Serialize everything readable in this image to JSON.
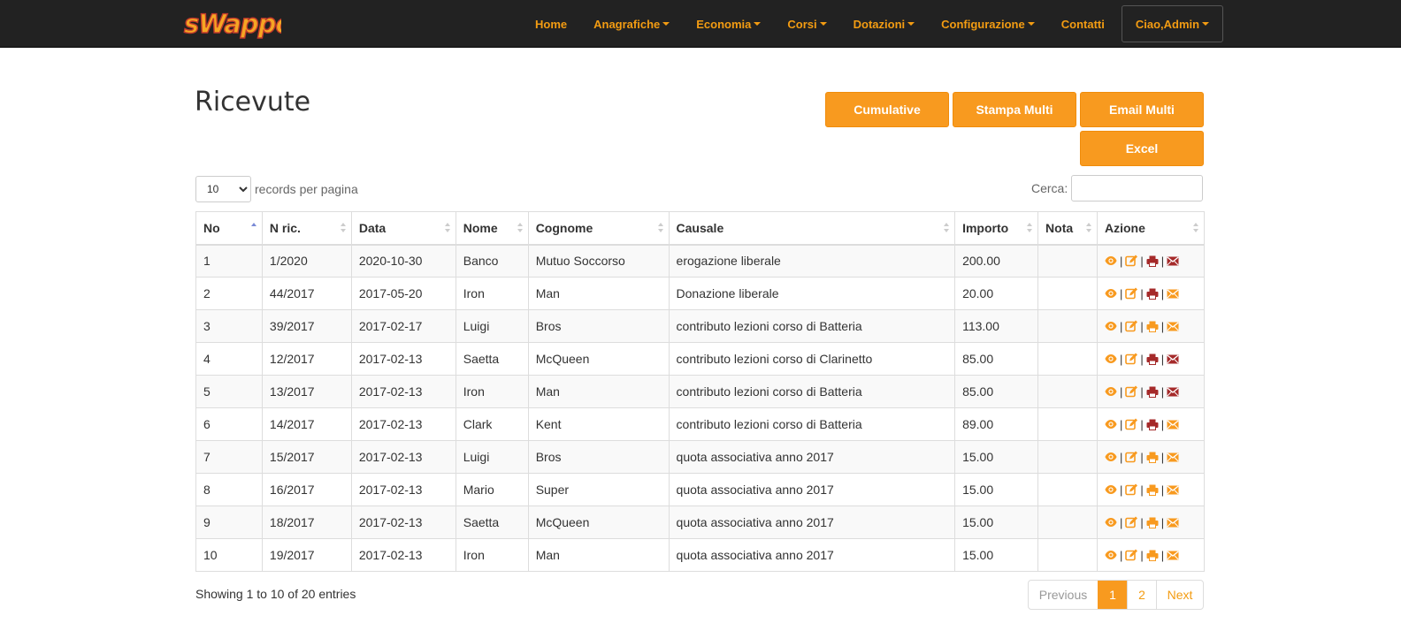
{
  "app": {
    "logo_text": "SWAPPO",
    "colors": {
      "navbar": "#222222",
      "accent": "#f89a1f",
      "accent_text": "#f39c12",
      "icon_dark": "#a52a2a"
    }
  },
  "nav": {
    "items": [
      {
        "label": "Home",
        "has_caret": false
      },
      {
        "label": "Anagrafiche",
        "has_caret": true
      },
      {
        "label": "Economia",
        "has_caret": true
      },
      {
        "label": "Corsi",
        "has_caret": true
      },
      {
        "label": "Dotazioni",
        "has_caret": true
      },
      {
        "label": "Configurazione",
        "has_caret": true
      },
      {
        "label": "Contatti",
        "has_caret": false
      }
    ],
    "user_label": "Ciao,Admin"
  },
  "page": {
    "title": "Ricevute",
    "buttons": {
      "cumulative": "Cumulative",
      "stampa_multi": "Stampa Multi",
      "email_multi": "Email Multi",
      "excel": "Excel"
    }
  },
  "controls": {
    "length_value": "10",
    "length_label": "records per pagina",
    "search_label": "Cerca:",
    "search_value": ""
  },
  "table": {
    "columns": [
      "No",
      "N ric.",
      "Data",
      "Nome",
      "Cognome",
      "Causale",
      "Importo",
      "Nota",
      "Azione"
    ],
    "rows": [
      {
        "no": "1",
        "nric": "1/2020",
        "data": "2020-10-30",
        "nome": "Banco",
        "cognome": "Mutuo Soccorso",
        "causale": "erogazione liberale",
        "importo": "200.00",
        "nota": "",
        "print_icon": "dark",
        "mail_icon": "dark"
      },
      {
        "no": "2",
        "nric": "44/2017",
        "data": "2017-05-20",
        "nome": "Iron",
        "cognome": "Man",
        "causale": "Donazione liberale",
        "importo": "20.00",
        "nota": "",
        "print_icon": "dark",
        "mail_icon": "orange"
      },
      {
        "no": "3",
        "nric": "39/2017",
        "data": "2017-02-17",
        "nome": "Luigi",
        "cognome": "Bros",
        "causale": "contributo lezioni corso di Batteria",
        "importo": "113.00",
        "nota": "",
        "print_icon": "orange",
        "mail_icon": "orange"
      },
      {
        "no": "4",
        "nric": "12/2017",
        "data": "2017-02-13",
        "nome": "Saetta",
        "cognome": "McQueen",
        "causale": "contributo lezioni corso di Clarinetto",
        "importo": "85.00",
        "nota": "",
        "print_icon": "dark",
        "mail_icon": "dark"
      },
      {
        "no": "5",
        "nric": "13/2017",
        "data": "2017-02-13",
        "nome": "Iron",
        "cognome": "Man",
        "causale": "contributo lezioni corso di Batteria",
        "importo": "85.00",
        "nota": "",
        "print_icon": "dark",
        "mail_icon": "dark"
      },
      {
        "no": "6",
        "nric": "14/2017",
        "data": "2017-02-13",
        "nome": "Clark",
        "cognome": "Kent",
        "causale": "contributo lezioni corso di Batteria",
        "importo": "89.00",
        "nota": "",
        "print_icon": "dark",
        "mail_icon": "orange"
      },
      {
        "no": "7",
        "nric": "15/2017",
        "data": "2017-02-13",
        "nome": "Luigi",
        "cognome": "Bros",
        "causale": "quota associativa anno 2017",
        "importo": "15.00",
        "nota": "",
        "print_icon": "orange",
        "mail_icon": "orange"
      },
      {
        "no": "8",
        "nric": "16/2017",
        "data": "2017-02-13",
        "nome": "Mario",
        "cognome": "Super",
        "causale": "quota associativa anno 2017",
        "importo": "15.00",
        "nota": "",
        "print_icon": "orange",
        "mail_icon": "orange"
      },
      {
        "no": "9",
        "nric": "18/2017",
        "data": "2017-02-13",
        "nome": "Saetta",
        "cognome": "McQueen",
        "causale": "quota associativa anno 2017",
        "importo": "15.00",
        "nota": "",
        "print_icon": "orange",
        "mail_icon": "orange"
      },
      {
        "no": "10",
        "nric": "19/2017",
        "data": "2017-02-13",
        "nome": "Iron",
        "cognome": "Man",
        "causale": "quota associativa anno 2017",
        "importo": "15.00",
        "nota": "",
        "print_icon": "orange",
        "mail_icon": "orange"
      }
    ],
    "action_icons": [
      "eye-icon",
      "edit-icon",
      "print-icon",
      "envelope-icon"
    ],
    "separator": "|"
  },
  "footer": {
    "info": "Showing 1 to 10 of 20 entries",
    "pager": {
      "previous": "Previous",
      "pages": [
        "1",
        "2"
      ],
      "next": "Next",
      "current": "1"
    }
  }
}
